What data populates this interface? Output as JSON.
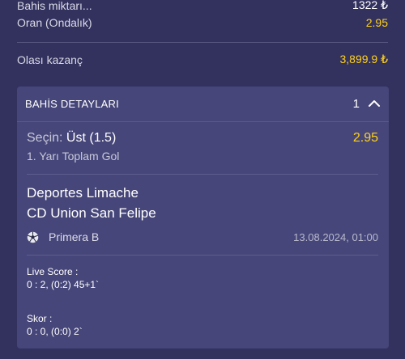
{
  "summary": {
    "stake_label": "Bahis miktarı...",
    "stake_value": "1322 ₺",
    "odds_label": "Oran (Ondalık)",
    "odds_value": "2.95",
    "potential_label": "Olası kazanç",
    "potential_value": "3,899.9 ₺"
  },
  "details": {
    "title": "BAHİS DETAYLARI",
    "count": "1",
    "selection_prefix": "Seçin:",
    "selection_value": "Üst (1.5)",
    "selection_odds": "2.95",
    "market": "1. Yarı Toplam Gol",
    "home_team": "Deportes Limache",
    "away_team": "CD Union San Felipe",
    "league": "Primera B",
    "datetime": "13.08.2024, 01:00",
    "live_score_label": "Live Score :",
    "live_score_value": "0 : 2, (0:2) 45+1`",
    "score_label": "Skor :",
    "score_value": "0 : 0, (0:0) 2`"
  },
  "colors": {
    "background": "#33325f",
    "card": "#46467a",
    "accent_yellow": "#ffd11a"
  },
  "icons": {
    "collapse": "chevron-up-icon",
    "sport": "soccer-ball-icon"
  }
}
